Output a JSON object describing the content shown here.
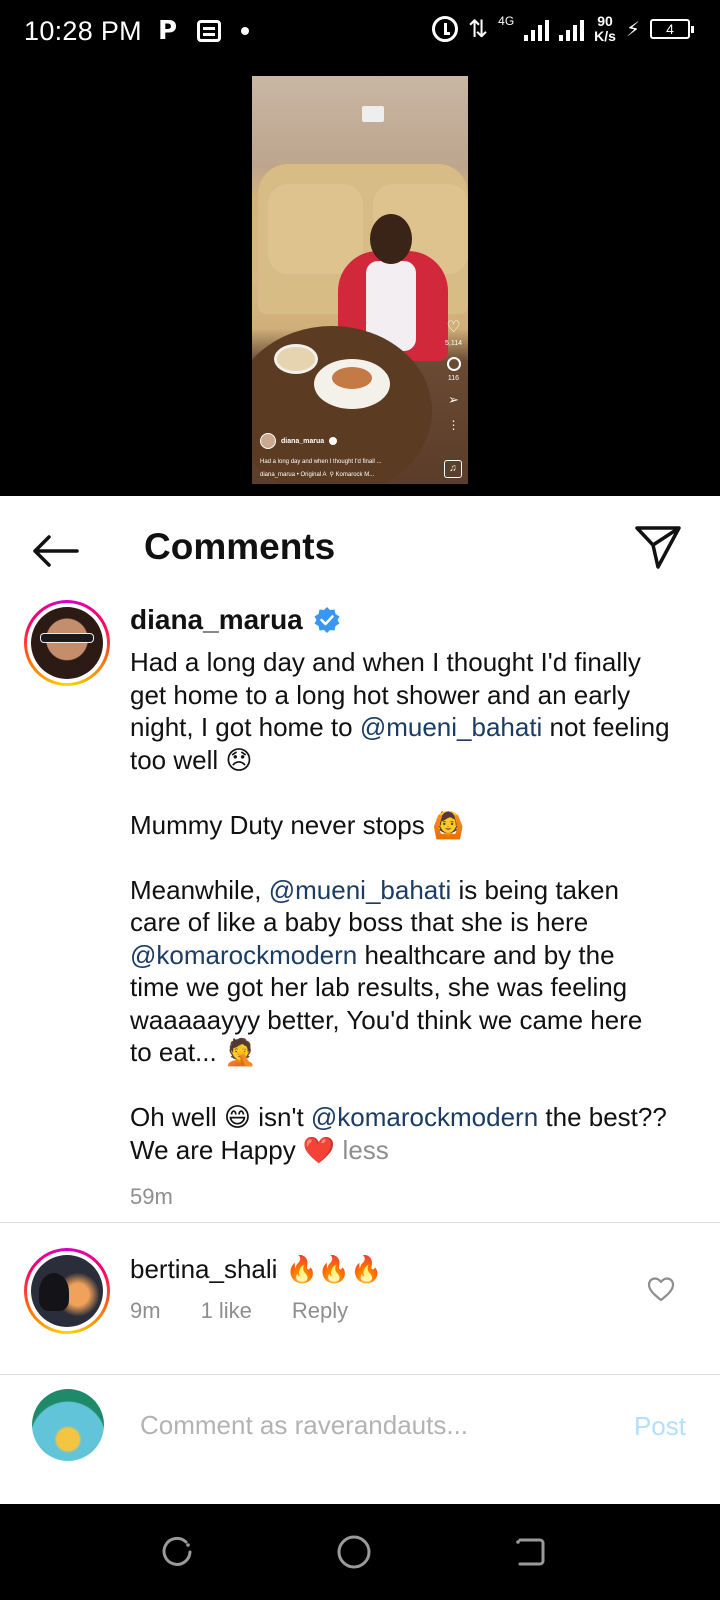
{
  "status_bar": {
    "time": "10:28 PM",
    "network": "4G",
    "speed_value": "90",
    "speed_unit": "K/s",
    "battery": "4"
  },
  "video": {
    "likes": "5,114",
    "comments": "116",
    "username": "diana_marua",
    "caption": "Had a long day and when I thought I'd finall ...",
    "audio": "diana_marua • Original A",
    "location": "Komarock M..."
  },
  "header": {
    "title": "Comments"
  },
  "caption": {
    "username": "diana_marua",
    "p1_a": "Had a long day and when I thought I'd finally get home to a long hot shower and an early night, I got home to ",
    "p1_mention": "@mueni_bahati",
    "p1_b": " not  feeling too well 😞",
    "p2": "Mummy Duty never stops 🙆",
    "p3_a": "Meanwhile, ",
    "p3_mention1": "@mueni_bahati",
    "p3_b": " is being taken care of like a baby boss that she is here ",
    "p3_mention2": "@komarockmodern",
    "p3_c": " healthcare and by the time we got her lab results, she was feeling waaaaayyy better, You'd think we came here to eat... 🤦",
    "p4_a": "Oh well 😄 isn't ",
    "p4_mention": "@komarockmodern",
    "p4_b": " the best?? We are Happy ❤️ ",
    "more": "less",
    "time": "59m"
  },
  "comments": [
    {
      "username": "bertina_shali",
      "text": "🔥🔥🔥",
      "time": "9m",
      "likes": "1 like",
      "reply": "Reply"
    }
  ],
  "input": {
    "placeholder": "Comment as raverandauts...",
    "post": "Post"
  },
  "colors": {
    "mention": "#1b3c64",
    "muted": "#8e8e8e",
    "post_disabled": "#b2dffc",
    "verified": "#3897f0"
  }
}
